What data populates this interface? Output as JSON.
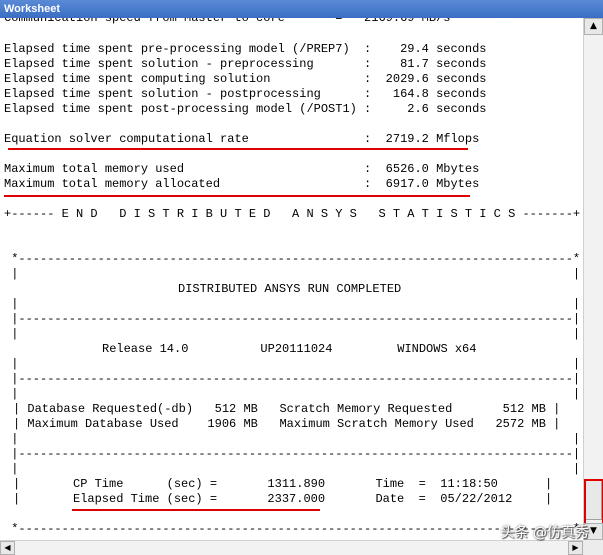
{
  "window": {
    "title": "Worksheet"
  },
  "log": {
    "lines": [
      "Elapsed time spent pre-processing model (/PREP7)  :    29.4 seconds",
      "Elapsed time spent solution - preprocessing       :    81.7 seconds",
      "Elapsed time spent computing solution             :  2029.6 seconds",
      "Elapsed time spent solution - postprocessing      :   164.8 seconds",
      "Elapsed time spent post-processing model (/POST1) :     2.6 seconds",
      "Equation solver computational rate                :  2719.2 Mflops",
      "Maximum total memory used                         :  6526.0 Mbytes",
      "Maximum total memory allocated                    :  6917.0 Mbytes",
      "+------ E N D   D I S T R I B U T E D   A N S Y S   S T A T I S T I C S -------+"
    ]
  },
  "report": {
    "border_lines": [
      " *-----------------------------------------------------------------------------*",
      " |                                                                             |",
      " |                                                                             |",
      " |-----------------------------------------------------------------------------|",
      " |                                                                             |",
      " |                                                                             |",
      " |-----------------------------------------------------------------------------|",
      " |                                                                             |",
      " |                                                                             |",
      " |                                                                             |",
      " |-----------------------------------------------------------------------------|",
      " |                                                                             |",
      " |                                                                             |",
      " |                                                                             |",
      " *-----------------------------------------------------------------------------*"
    ],
    "title": "DISTRIBUTED ANSYS RUN COMPLETED",
    "release_line": "Release 14.0          UP20111024         WINDOWS x64",
    "memory_lines": [
      "Database Requested(-db)   512 MB   Scratch Memory Requested       512 MB",
      "Maximum Database Used    1906 MB   Maximum Scratch Memory Used   2572 MB"
    ],
    "time_lines": [
      "CP Time      (sec) =       1311.890       Time  =  11:18:50",
      "Elapsed Time (sec) =       2337.000       Date  =  05/22/2012"
    ]
  },
  "watermark": "头条 @仿真秀",
  "colors": {
    "highlight": "#e00000",
    "titlebar": "#3a6ec4"
  }
}
